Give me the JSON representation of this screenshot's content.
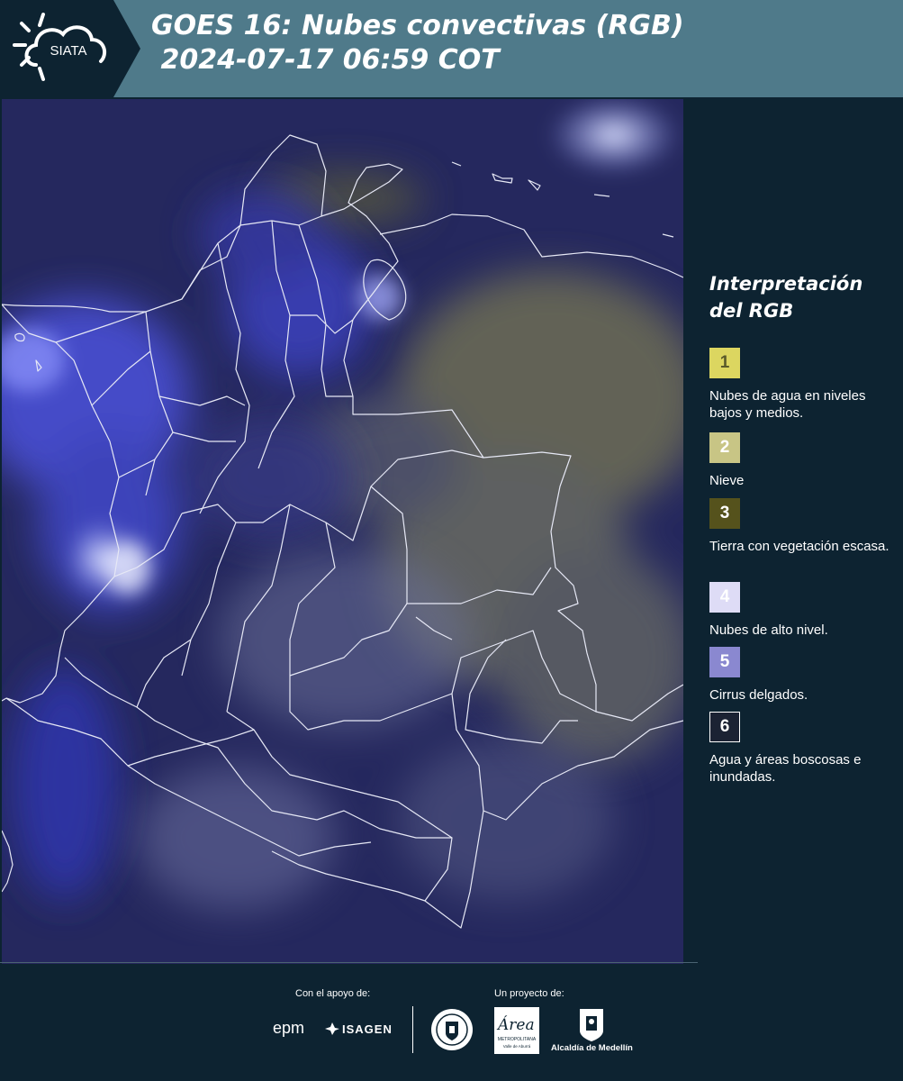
{
  "header": {
    "logo_text": "SIATA",
    "title_line1": "GOES 16: Nubes convectivas (RGB)",
    "title_line2": " 2024-07-17 06:59 COT",
    "background_color": "#4f7a8a"
  },
  "legend": {
    "title_line1": "Interpretación",
    "title_line2": "del RGB",
    "items": [
      {
        "number": "1",
        "description": "Nubes de agua en niveles bajos y medios.",
        "color": "#dcd660",
        "text_color": "#5a5a2a"
      },
      {
        "number": "2",
        "description": "Nieve",
        "color": "#c8c585",
        "text_color": "#ffffff"
      },
      {
        "number": "3",
        "description": "Tierra con vegetación escasa.",
        "color": "#55521c",
        "text_color": "#ffffff"
      },
      {
        "number": "4",
        "description": "Nubes de alto nivel.",
        "color": "#dedcf6",
        "text_color": "#ffffff"
      },
      {
        "number": "5",
        "description": "Cirrus delgados.",
        "color": "#8a88d0",
        "text_color": "#ffffff"
      },
      {
        "number": "6",
        "description": "Agua y áreas boscosas e inundadas.",
        "color": "#1b2233",
        "text_color": "#ffffff"
      }
    ]
  },
  "footer": {
    "support_label": "Con el apoyo de:",
    "project_label": "Un proyecto de:",
    "sponsor_epm": "epm",
    "sponsor_isagen": "ISAGEN",
    "partner_area_line1": "Área",
    "partner_area_line2": "METROPOLITANA",
    "partner_area_line3": "Valle de Aburrá",
    "partner_alcaldia": "Alcaldía de Medellín"
  }
}
